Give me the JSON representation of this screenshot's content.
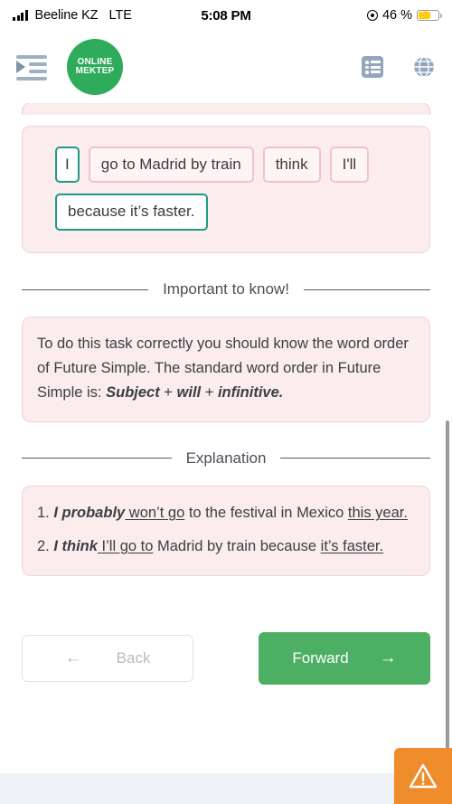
{
  "status_bar": {
    "carrier": "Beeline KZ",
    "network": "LTE",
    "time": "5:08 PM",
    "battery_percent": "46 %",
    "battery_charging": true,
    "location_icon": "location-icon"
  },
  "header": {
    "menu_icon": "indent-menu-icon",
    "logo_line1": "ONLINE",
    "logo_line2": "MEKTEP",
    "logo_color": "#2eab5b",
    "list_icon": "list-icon",
    "globe_icon": "globe-icon"
  },
  "answer_area": {
    "chips": [
      {
        "text": "I",
        "state": "selected",
        "border": "#1f9b85"
      },
      {
        "text": "go to Madrid by train",
        "state": "unselected",
        "border": "#f3c2c8"
      },
      {
        "text": "think",
        "state": "unselected",
        "border": "#f3c2c8"
      },
      {
        "text": "I'll",
        "state": "unselected",
        "border": "#f3c2c8"
      },
      {
        "text": "because it’s faster.",
        "state": "selected",
        "border": "#1f9b85"
      }
    ]
  },
  "sections": {
    "important_title": "Important to know!",
    "explanation_title": "Explanation"
  },
  "important_box": {
    "lead": "To do this task correctly you should know the word order of Future Simple. The standard word order in Future Simple is: ",
    "bold1": "Subject",
    "plus1": " + ",
    "bold2": "will",
    "plus2": " + ",
    "bold3": "infinitive."
  },
  "explanation_box": {
    "item1": {
      "number": "1. ",
      "bold": "I probably",
      "underline1": " won’t go",
      "plain": " to the festival in Mexico ",
      "underline2": "this year."
    },
    "item2": {
      "number": "2. ",
      "bold": "I think",
      "underline1": " I’ll go to",
      "plain": " Madrid by train because ",
      "underline2": "it’s faster."
    }
  },
  "nav": {
    "back_label": "Back",
    "back_arrow": "←",
    "forward_label": "Forward",
    "forward_arrow": "→",
    "forward_color": "#4caf63"
  },
  "report": {
    "icon": "warning-triangle-icon",
    "color": "#ef8c2b"
  }
}
